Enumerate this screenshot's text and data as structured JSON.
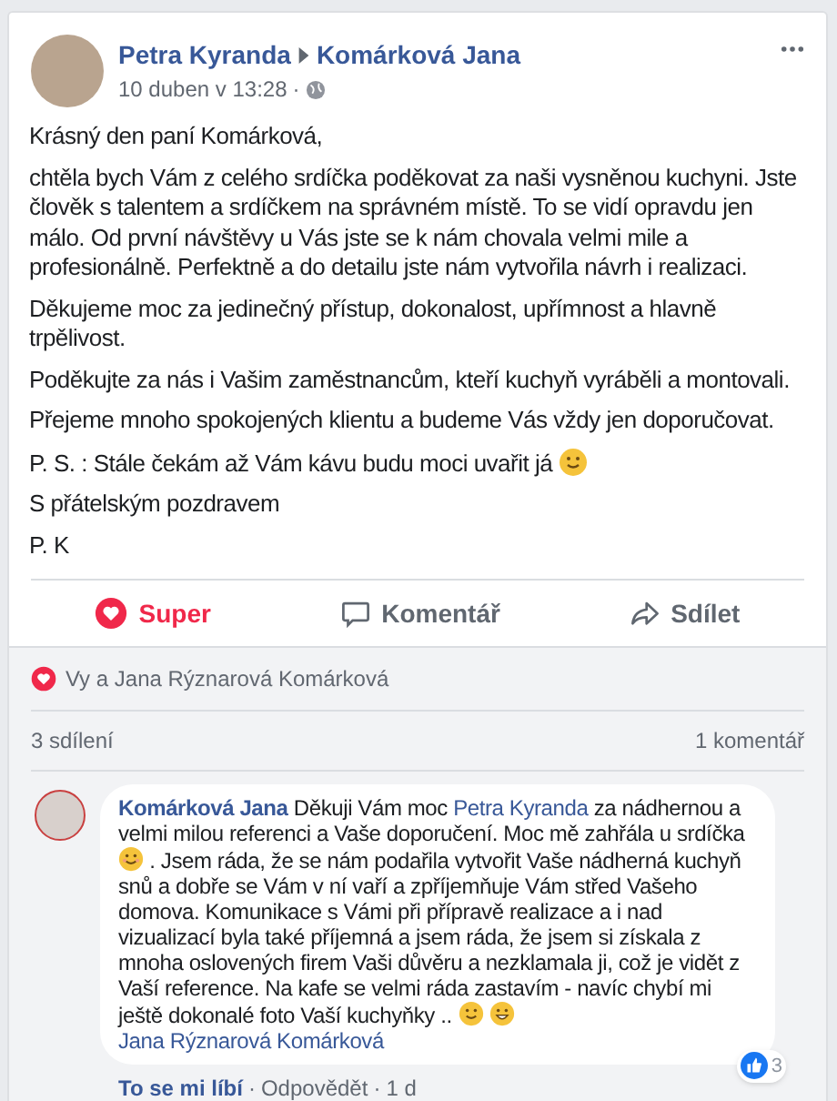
{
  "post": {
    "author": "Petra Kyranda",
    "target": "Komárková Jana",
    "time": "10 duben v 13:28",
    "separator": "·",
    "paragraphs": [
      {
        "text": "Krásný den paní Komárková,"
      },
      {
        "text": "chtěla bych Vám z celého srdíčka poděkovat za naši vysněnou kuchyni. Jste člověk s talentem a srdíčkem na správném místě. To se vidí opravdu jen málo. Od první návštěvy u Vás jste se k nám chovala velmi mile a profesionálně. Perfektně a do detailu jste nám vytvořila návrh i realizaci."
      },
      {
        "text": "Děkujeme moc za jedinečný přístup, dokonalost, upřímnost a hlavně trpělivost."
      },
      {
        "text": "Poděkujte za nás i Vašim zaměstnancům, kteří kuchyň vyráběli a montovali."
      },
      {
        "text": "Přejeme mnoho spokojených klientu a budeme Vás vždy jen doporučovat."
      },
      {
        "text": "P. S. : Stále čekám až Vám kávu budu moci uvařit já",
        "emoji": {
          "kind": "smile"
        }
      },
      {
        "text": "S přátelským pozdravem"
      },
      {
        "text": "P. K"
      }
    ]
  },
  "actions": [
    {
      "kind": "heart",
      "label": "Super",
      "selected": true
    },
    {
      "kind": "comment",
      "label": "Komentář",
      "selected": false
    },
    {
      "kind": "share",
      "label": "Sdílet",
      "selected": false
    }
  ],
  "reactions": {
    "text": "Vy a Jana Rýznarová Komárková"
  },
  "counts": {
    "shares": "3 sdílení",
    "comments": "1 komentář"
  },
  "comment": {
    "author": "Komárková Jana",
    "segments": [
      {
        "kind": "text",
        "text": "Děkuji Vám moc"
      },
      {
        "kind": "mention",
        "text": "Petra Kyranda"
      },
      {
        "kind": "text",
        "text": "za nádhernou a velmi milou referenci a Vaše doporučení. Moc mě zahřála u srdíčka"
      },
      {
        "kind": "blush"
      },
      {
        "kind": "text",
        "text": ". Jsem ráda, že se nám podařila vytvořit Vaše nádherná kuchyň snů a dobře se Vám v ní vaří a zpříjemňuje Vám střed Vašeho domova. Komunikace s Vámi při přípravě realizace a i nad vizualizací byla také příjemná a jsem ráda, že jsem si získala z mnoha oslovených firem Vaši důvěru a nezklamala ji, což je vidět z Vaší reference. Na kafe se velmi ráda zastavím - navíc chybí mi ještě dokonalé foto Vaší kuchyňky .."
      },
      {
        "kind": "smile"
      },
      {
        "kind": "grin"
      },
      {
        "kind": "mention",
        "text": "Jana Rýznarová Komárková"
      }
    ],
    "like": {
      "label": "To se mi líbí",
      "selected": true
    },
    "dot1": "·",
    "reply": "Odpovědět",
    "dot2": "·",
    "age": "1 d",
    "like_count": "3"
  }
}
